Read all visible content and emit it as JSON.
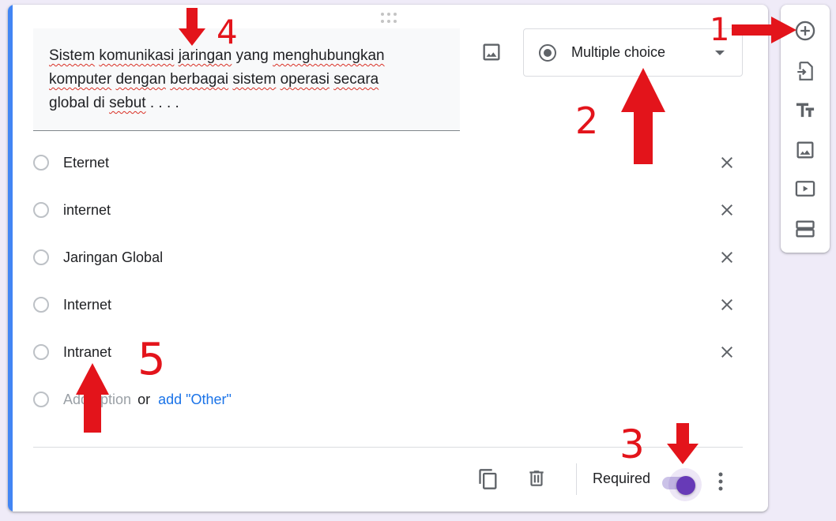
{
  "question": {
    "words": [
      "Sistem",
      " ",
      "komunikasi",
      " ",
      "jaringan",
      " yang ",
      "menghubungkan",
      " ",
      "komputer",
      " ",
      "dengan",
      " ",
      "berbagai",
      " ",
      "sistem",
      " ",
      "operasi",
      " ",
      "secara",
      " global di ",
      "sebut",
      " . . . ."
    ]
  },
  "type_select": {
    "label": "Multiple choice"
  },
  "options": [
    {
      "label": "Eternet"
    },
    {
      "label": "internet"
    },
    {
      "label": "Jaringan Global"
    },
    {
      "label": "Internet"
    },
    {
      "label": "Intranet"
    }
  ],
  "add_option": {
    "placeholder": "Add option",
    "or": "or",
    "other": "add \"Other\""
  },
  "footer": {
    "required_label": "Required",
    "required_on": true
  },
  "sidebar": [
    "add-question",
    "import-questions",
    "add-title",
    "add-image",
    "add-video",
    "add-section"
  ],
  "annotations": {
    "n1": "1",
    "n2": "2",
    "n3": "3",
    "n4": "4",
    "n5": "5"
  },
  "colors": {
    "accent": "#4285f4",
    "toggle": "#673ab7",
    "annotation": "#e3141b",
    "link": "#1a73e8"
  }
}
